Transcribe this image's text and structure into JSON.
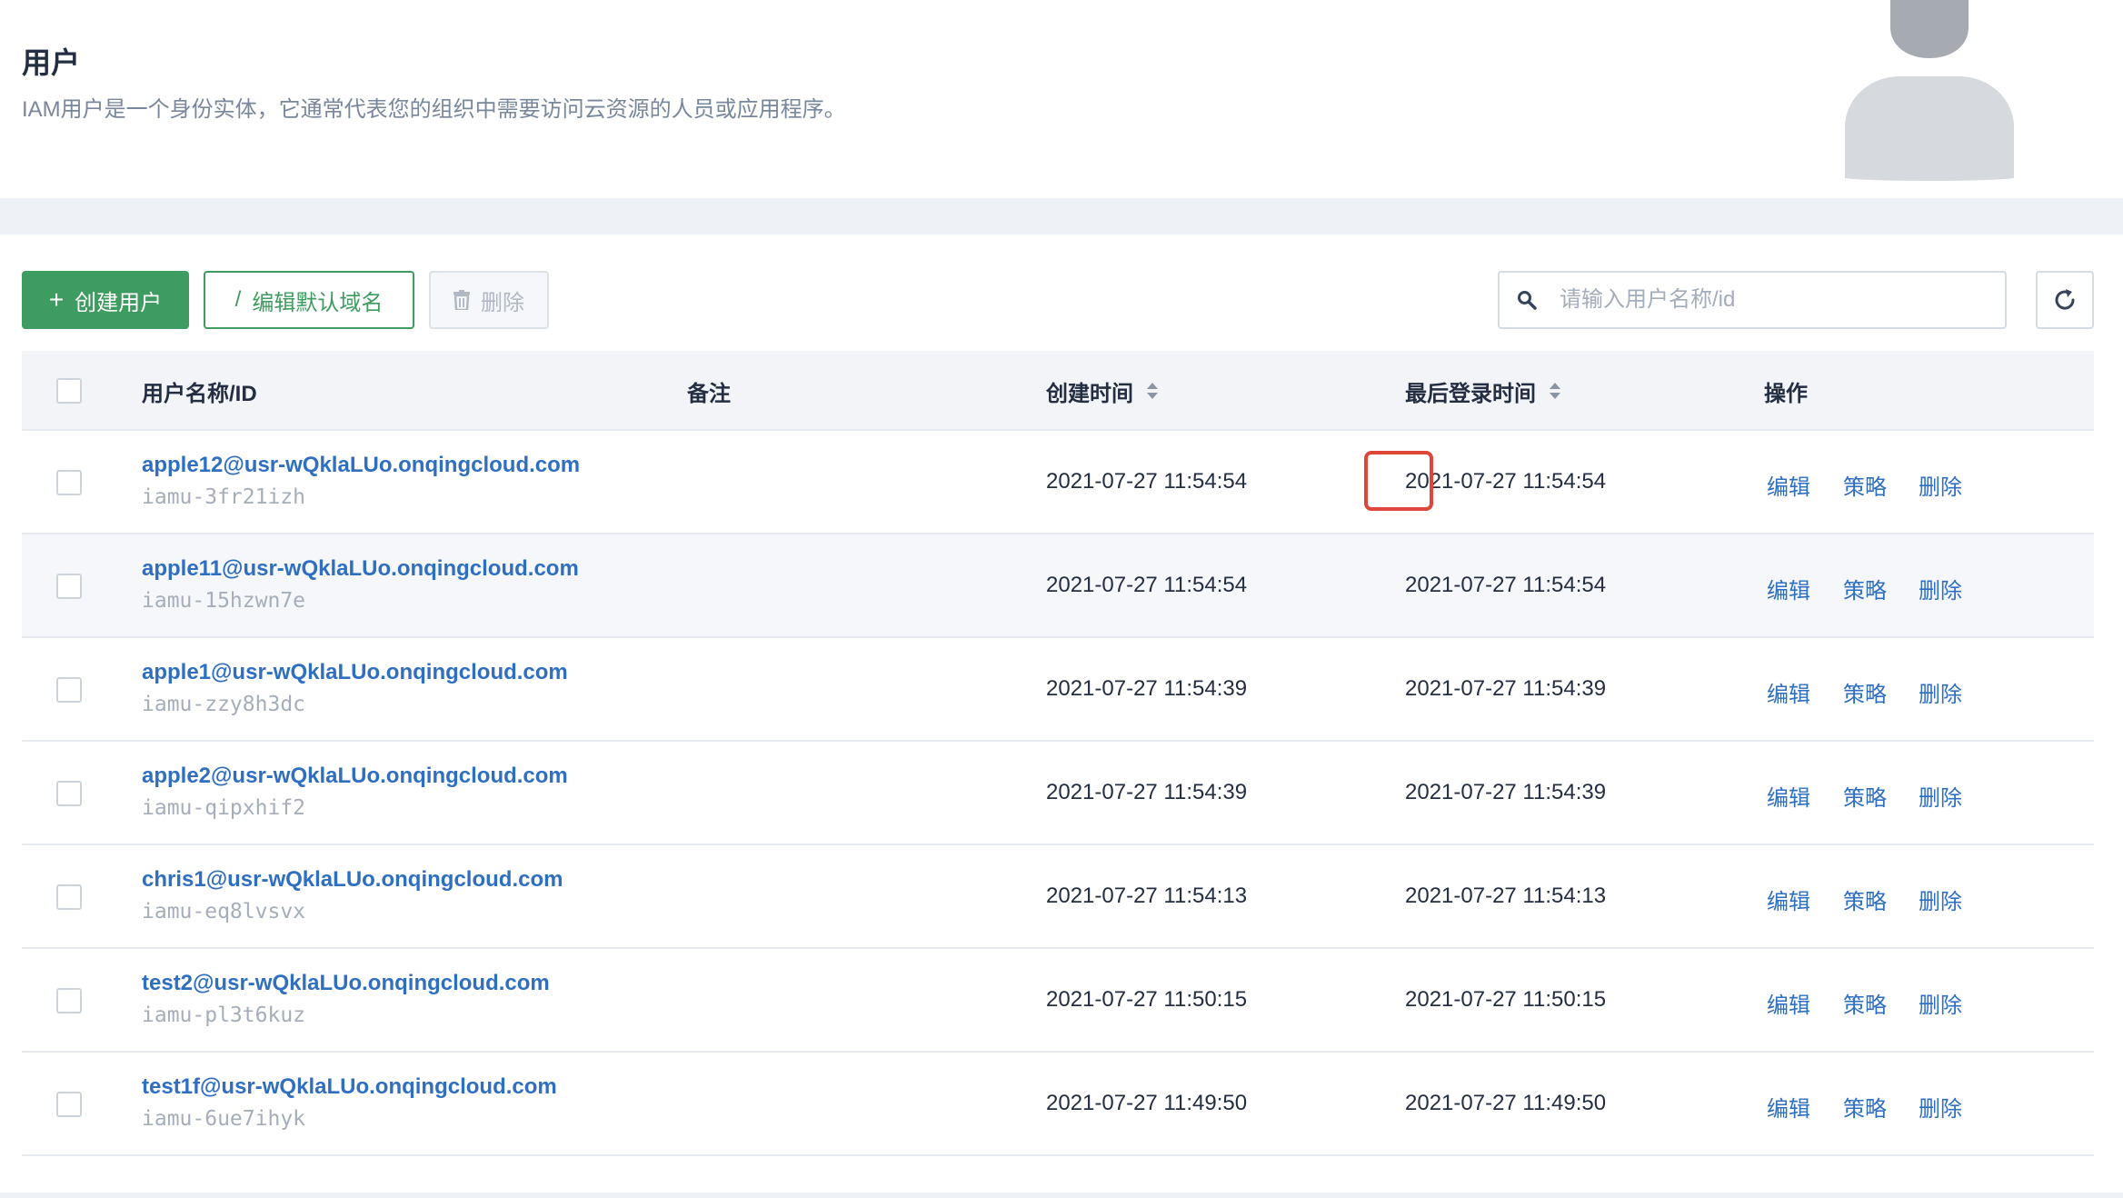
{
  "header": {
    "title": "用户",
    "description": "IAM用户是一个身份实体，它通常代表您的组织中需要访问云资源的人员或应用程序。"
  },
  "toolbar": {
    "create_label": "创建用户",
    "edit_domain_label": "编辑默认域名",
    "delete_label": "删除",
    "search_placeholder": "请输入用户名称/id"
  },
  "table": {
    "columns": {
      "name": "用户名称/ID",
      "remark": "备注",
      "created": "创建时间",
      "last_login": "最后登录时间",
      "actions": "操作"
    },
    "rows": [
      {
        "name": "apple12@usr-wQklaLUo.onqingcloud.com",
        "id": "iamu-3fr21izh",
        "created": "2021-07-27 11:54:54",
        "last_login": "2021-07-27 11:54:54",
        "edit": "编辑",
        "policy": "策略",
        "delete": "删除"
      },
      {
        "name": "apple11@usr-wQklaLUo.onqingcloud.com",
        "id": "iamu-15hzwn7e",
        "created": "2021-07-27 11:54:54",
        "last_login": "2021-07-27 11:54:54",
        "edit": "编辑",
        "policy": "策略",
        "delete": "删除"
      },
      {
        "name": "apple1@usr-wQklaLUo.onqingcloud.com",
        "id": "iamu-zzy8h3dc",
        "created": "2021-07-27 11:54:39",
        "last_login": "2021-07-27 11:54:39",
        "edit": "编辑",
        "policy": "策略",
        "delete": "删除"
      },
      {
        "name": "apple2@usr-wQklaLUo.onqingcloud.com",
        "id": "iamu-qipxhif2",
        "created": "2021-07-27 11:54:39",
        "last_login": "2021-07-27 11:54:39",
        "edit": "编辑",
        "policy": "策略",
        "delete": "删除"
      },
      {
        "name": "chris1@usr-wQklaLUo.onqingcloud.com",
        "id": "iamu-eq8lvsvx",
        "created": "2021-07-27 11:54:13",
        "last_login": "2021-07-27 11:54:13",
        "edit": "编辑",
        "policy": "策略",
        "delete": "删除"
      },
      {
        "name": "test2@usr-wQklaLUo.onqingcloud.com",
        "id": "iamu-pl3t6kuz",
        "created": "2021-07-27 11:50:15",
        "last_login": "2021-07-27 11:50:15",
        "edit": "编辑",
        "policy": "策略",
        "delete": "删除"
      },
      {
        "name": "test1f@usr-wQklaLUo.onqingcloud.com",
        "id": "iamu-6ue7ihyk",
        "created": "2021-07-27 11:49:50",
        "last_login": "2021-07-27 11:49:50",
        "edit": "编辑",
        "policy": "策略",
        "delete": "删除"
      }
    ]
  },
  "icons": {
    "create": "plus-icon",
    "edit": "pencil-icon",
    "delete": "trash-icon",
    "search": "search-icon",
    "refresh": "refresh-icon",
    "sort": "sort-icon",
    "avatar": "user-avatar-icon"
  },
  "colors": {
    "primary": "#3f9c60",
    "link": "#2f6fc1",
    "highlight": "#e0453a"
  }
}
